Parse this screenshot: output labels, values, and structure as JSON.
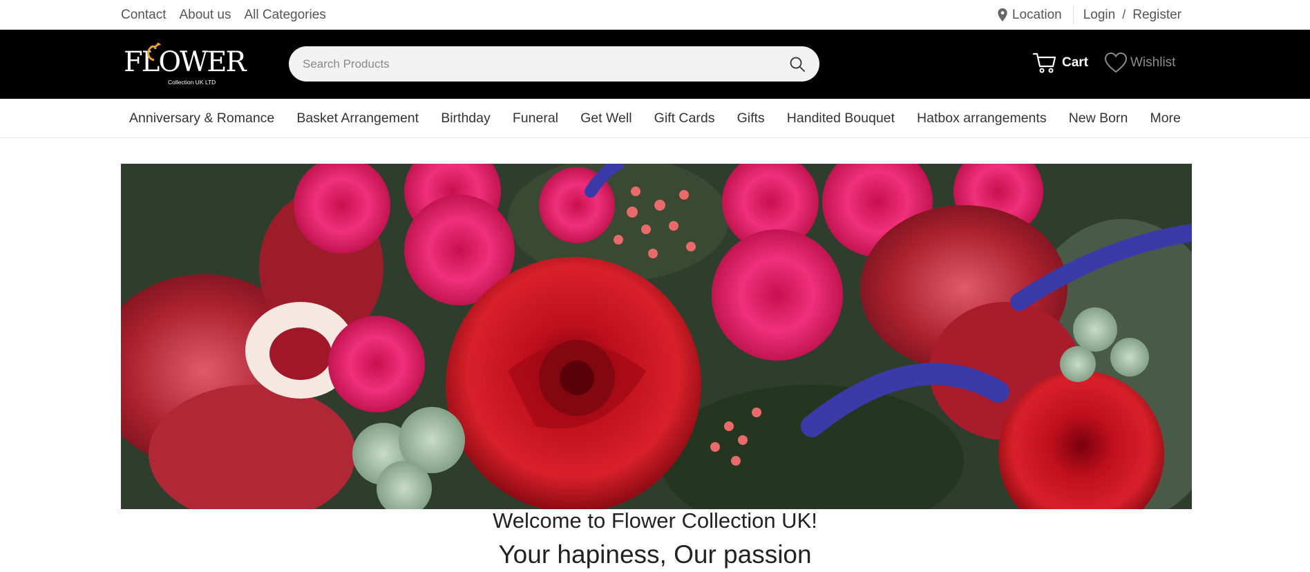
{
  "topbar": {
    "contact": "Contact",
    "about": "About us",
    "categories": "All Categories",
    "location": "Location",
    "login": "Login",
    "separator": "/",
    "register": "Register",
    "icons": {
      "location": "map-pin-icon"
    }
  },
  "header": {
    "logo_text": "FLOWER",
    "logo_subtext": "Collection UK LTD",
    "search_placeholder": "Search Products",
    "search_value": "",
    "cart_label": "Cart",
    "wishlist_label": "Wishlist",
    "icons": {
      "search": "search-icon",
      "cart": "cart-icon",
      "wishlist": "heart-icon"
    }
  },
  "nav": {
    "items": [
      {
        "label": "Anniversary & Romance"
      },
      {
        "label": "Basket Arrangement"
      },
      {
        "label": "Birthday"
      },
      {
        "label": "Funeral"
      },
      {
        "label": "Get Well"
      },
      {
        "label": "Gift Cards"
      },
      {
        "label": "Gifts"
      },
      {
        "label": "Handited Bouquet"
      },
      {
        "label": "Hatbox arrangements"
      },
      {
        "label": "New Born"
      },
      {
        "label": "More"
      }
    ]
  },
  "hero": {
    "welcome": "Welcome to Flower Collection UK!",
    "tagline": "Your hapiness, Our passion"
  },
  "colors": {
    "header_bg": "#000000",
    "logo_accent": "#f0a030",
    "search_bg": "#f2f2f2",
    "wishlist_text": "#8c8c8c"
  }
}
